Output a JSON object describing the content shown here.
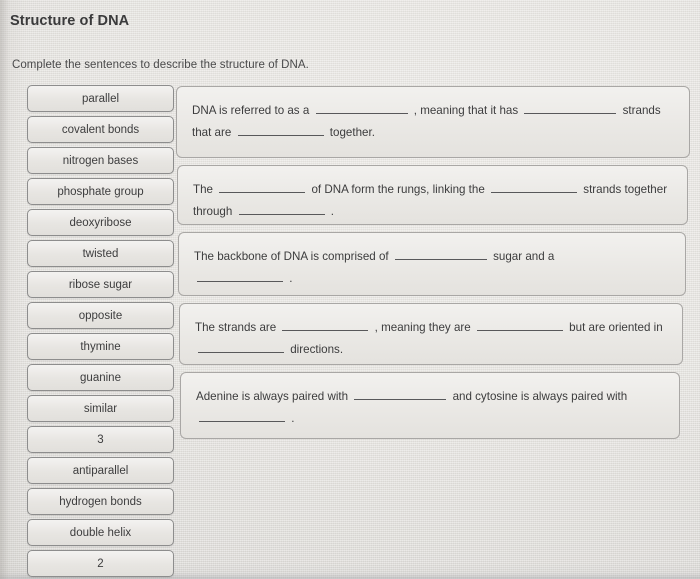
{
  "header": {
    "title": "Structure of DNA",
    "instructions": "Complete the sentences to describe the structure of DNA."
  },
  "word_bank": {
    "items": [
      {
        "label": "parallel"
      },
      {
        "label": "covalent bonds"
      },
      {
        "label": "nitrogen bases"
      },
      {
        "label": "phosphate group"
      },
      {
        "label": "deoxyribose"
      },
      {
        "label": "twisted"
      },
      {
        "label": "ribose sugar"
      },
      {
        "label": "opposite"
      },
      {
        "label": "thymine"
      },
      {
        "label": "guanine"
      },
      {
        "label": "similar"
      },
      {
        "label": "3"
      },
      {
        "label": "antiparallel"
      },
      {
        "label": "hydrogen bonds"
      },
      {
        "label": "double helix"
      },
      {
        "label": "2"
      }
    ]
  },
  "questions": [
    {
      "id": "q1",
      "segments": {
        "s1": "DNA is referred to as a",
        "s2": ", meaning that it has",
        "s3": "strands that are",
        "s4": "together."
      }
    },
    {
      "id": "q2",
      "segments": {
        "s1": "The",
        "s2": "of DNA form the rungs, linking the",
        "s3": "strands together through",
        "s4": "."
      }
    },
    {
      "id": "q3",
      "segments": {
        "s1": "The backbone of DNA is comprised of",
        "s2": "sugar and a",
        "s3": "."
      }
    },
    {
      "id": "q4",
      "segments": {
        "s1": "The strands are",
        "s2": ", meaning they are",
        "s3": "but are",
        "s4": "oriented in",
        "s5": "directions."
      }
    },
    {
      "id": "q5",
      "segments": {
        "s1": "Adenine is always paired with",
        "s2": "and cytosine is always paired",
        "s3": "with",
        "s4": "."
      }
    }
  ],
  "colors": {
    "page_background": "#dfddd9",
    "card_background": "#e7e5e1",
    "card_border": "#a9a7a5",
    "chip_border": "#8d8d8d",
    "text": "#3c3c3d"
  }
}
